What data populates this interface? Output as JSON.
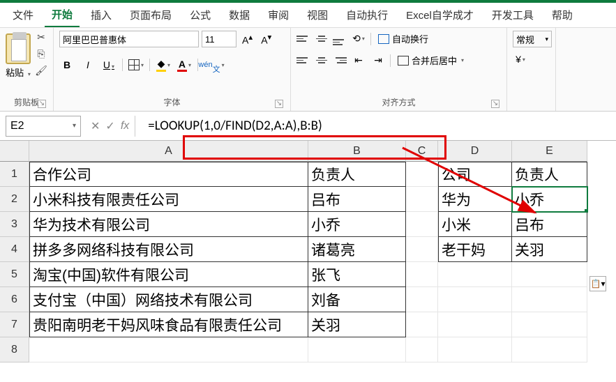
{
  "menu": {
    "items": [
      "文件",
      "开始",
      "插入",
      "页面布局",
      "公式",
      "数据",
      "审阅",
      "视图",
      "自动执行",
      "Excel自学成才",
      "开发工具",
      "帮助"
    ],
    "active_index": 1
  },
  "ribbon": {
    "clipboard": {
      "paste_label": "粘贴",
      "group_label": "剪贴板"
    },
    "font": {
      "name": "阿里巴巴普惠体",
      "size": "11",
      "group_label": "字体",
      "pinyin_label": "wén"
    },
    "align": {
      "group_label": "对齐方式",
      "wrap_label": "自动换行",
      "merge_label": "合并后居中"
    },
    "number": {
      "format": "常规"
    }
  },
  "formula_bar": {
    "name_box": "E2",
    "formula": "=LOOKUP(1,0/FIND(D2,A:A),B:B)"
  },
  "cols": [
    "A",
    "B",
    "C",
    "D",
    "E"
  ],
  "rows": [
    1,
    2,
    3,
    4,
    5,
    6,
    7,
    8
  ],
  "cells": {
    "r1": {
      "A": "合作公司",
      "B": "负责人",
      "D": "公司",
      "E": "负责人"
    },
    "r2": {
      "A": "小米科技有限责任公司",
      "B": "吕布",
      "D": "华为",
      "E": "小乔"
    },
    "r3": {
      "A": "华为技术有限公司",
      "B": "小乔",
      "D": "小米",
      "E": "吕布"
    },
    "r4": {
      "A": "拼多多网络科技有限公司",
      "B": "诸葛亮",
      "D": "老干妈",
      "E": "关羽"
    },
    "r5": {
      "A": "淘宝(中国)软件有限公司",
      "B": "张飞"
    },
    "r6": {
      "A": "支付宝（中国）网络技术有限公司",
      "B": "刘备"
    },
    "r7": {
      "A": "贵阳南明老干妈风味食品有限责任公司",
      "B": "关羽"
    }
  },
  "chart_data": {
    "type": "table",
    "tables": [
      {
        "columns": [
          "合作公司",
          "负责人"
        ],
        "rows": [
          [
            "小米科技有限责任公司",
            "吕布"
          ],
          [
            "华为技术有限公司",
            "小乔"
          ],
          [
            "拼多多网络科技有限公司",
            "诸葛亮"
          ],
          [
            "淘宝(中国)软件有限公司",
            "张飞"
          ],
          [
            "支付宝（中国）网络技术有限公司",
            "刘备"
          ],
          [
            "贵阳南明老干妈风味食品有限责任公司",
            "关羽"
          ]
        ]
      },
      {
        "columns": [
          "公司",
          "负责人"
        ],
        "rows": [
          [
            "华为",
            "小乔"
          ],
          [
            "小米",
            "吕布"
          ],
          [
            "老干妈",
            "关羽"
          ]
        ]
      }
    ]
  }
}
